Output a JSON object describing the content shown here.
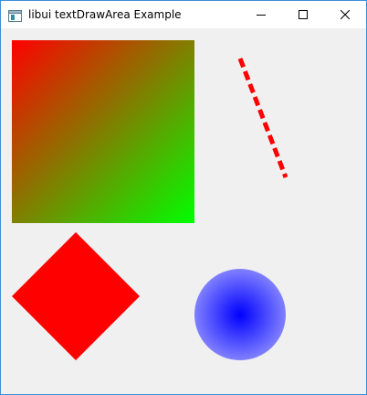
{
  "window": {
    "title": "libui textDrawArea Example",
    "border_color": "#3c8fd9"
  },
  "titlebar": {
    "app_icon": "window-app-icon",
    "minimize_icon": "minimize-icon",
    "maximize_icon": "maximize-icon",
    "close_icon": "close-icon"
  },
  "area": {
    "background": "#f0f0f0",
    "shapes": [
      {
        "name": "gradient-square",
        "kind": "square",
        "gradient": "linear",
        "colors": [
          "#ff0000",
          "#00ff00"
        ]
      },
      {
        "name": "dashed-line",
        "kind": "line",
        "style": "dashed",
        "color": "#ff0000"
      },
      {
        "name": "red-diamond",
        "kind": "diamond",
        "color": "#ff0000"
      },
      {
        "name": "radial-circle",
        "kind": "circle",
        "gradient": "radial",
        "colors": [
          "#0000ff",
          "#8080ff"
        ]
      }
    ]
  }
}
